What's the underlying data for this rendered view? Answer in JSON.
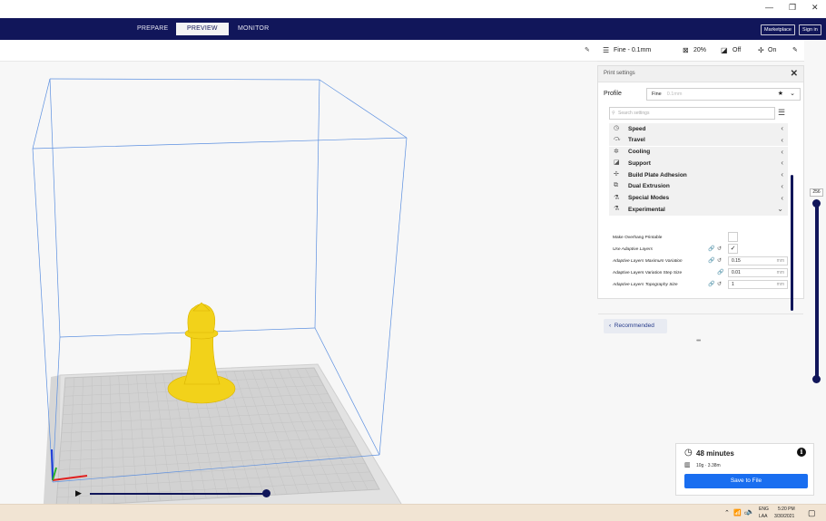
{
  "window": {
    "minimize_glyph": "—",
    "restore_glyph": "❐",
    "close_glyph": "✕"
  },
  "header": {
    "tabs": [
      "PREPARE",
      "PREVIEW",
      "MONITOR"
    ],
    "active_tab": "PREVIEW",
    "marketplace": "Marketplace",
    "sign_in": "Sign in"
  },
  "quick_settings": {
    "profile": "Fine - 0.1mm",
    "infill": "20%",
    "support": "Off",
    "adhesion": "On"
  },
  "print_settings": {
    "title": "Print settings",
    "profile_label": "Profile",
    "profile_value": "Fine",
    "profile_value_dim": "0.1mm",
    "search_placeholder": "Search settings",
    "categories": [
      {
        "label": "Speed",
        "icon": "speed-icon",
        "glyph": "◷",
        "expanded": false
      },
      {
        "label": "Travel",
        "icon": "travel-icon",
        "glyph": "⤼",
        "expanded": false
      },
      {
        "label": "Cooling",
        "icon": "cooling-icon",
        "glyph": "✲",
        "expanded": false
      },
      {
        "label": "Support",
        "icon": "support-icon",
        "glyph": "◪",
        "expanded": false
      },
      {
        "label": "Build Plate Adhesion",
        "icon": "adhesion-icon",
        "glyph": "✢",
        "expanded": false
      },
      {
        "label": "Dual Extrusion",
        "icon": "dual-extrusion-icon",
        "glyph": "⧉",
        "expanded": false
      },
      {
        "label": "Special Modes",
        "icon": "special-modes-icon",
        "glyph": "⚗",
        "expanded": false
      },
      {
        "label": "Experimental",
        "icon": "experimental-icon",
        "glyph": "⚗",
        "expanded": true
      }
    ],
    "settings": [
      {
        "label": "Make Overhang Printable",
        "value": "",
        "unit": "",
        "checked": false
      },
      {
        "label": "Use Adaptive Layers",
        "value": "",
        "unit": "",
        "checked": true
      },
      {
        "label": "Adaptive Layers Maximum Variation",
        "value": "0.15",
        "unit": "mm"
      },
      {
        "label": "Adaptive Layers Variation Step Size",
        "value": "0.01",
        "unit": "mm"
      },
      {
        "label": "Adaptive Layers Topography Size",
        "value": "1",
        "unit": "mm"
      }
    ],
    "recommended": "Recommended"
  },
  "layer_slider": {
    "value": "256"
  },
  "estimate": {
    "time": "48 minutes",
    "material": "10g · 3.38m",
    "save_button": "Save to File"
  },
  "taskbar": {
    "lang1": "ENG",
    "lang2": "LAA",
    "time": "5:20 PM",
    "date": "3/30/2021"
  },
  "colors": {
    "header_bg": "#11165a",
    "accent": "#196ef0",
    "model": "#f2d21a",
    "volume_lines": "#5b8fe0"
  }
}
